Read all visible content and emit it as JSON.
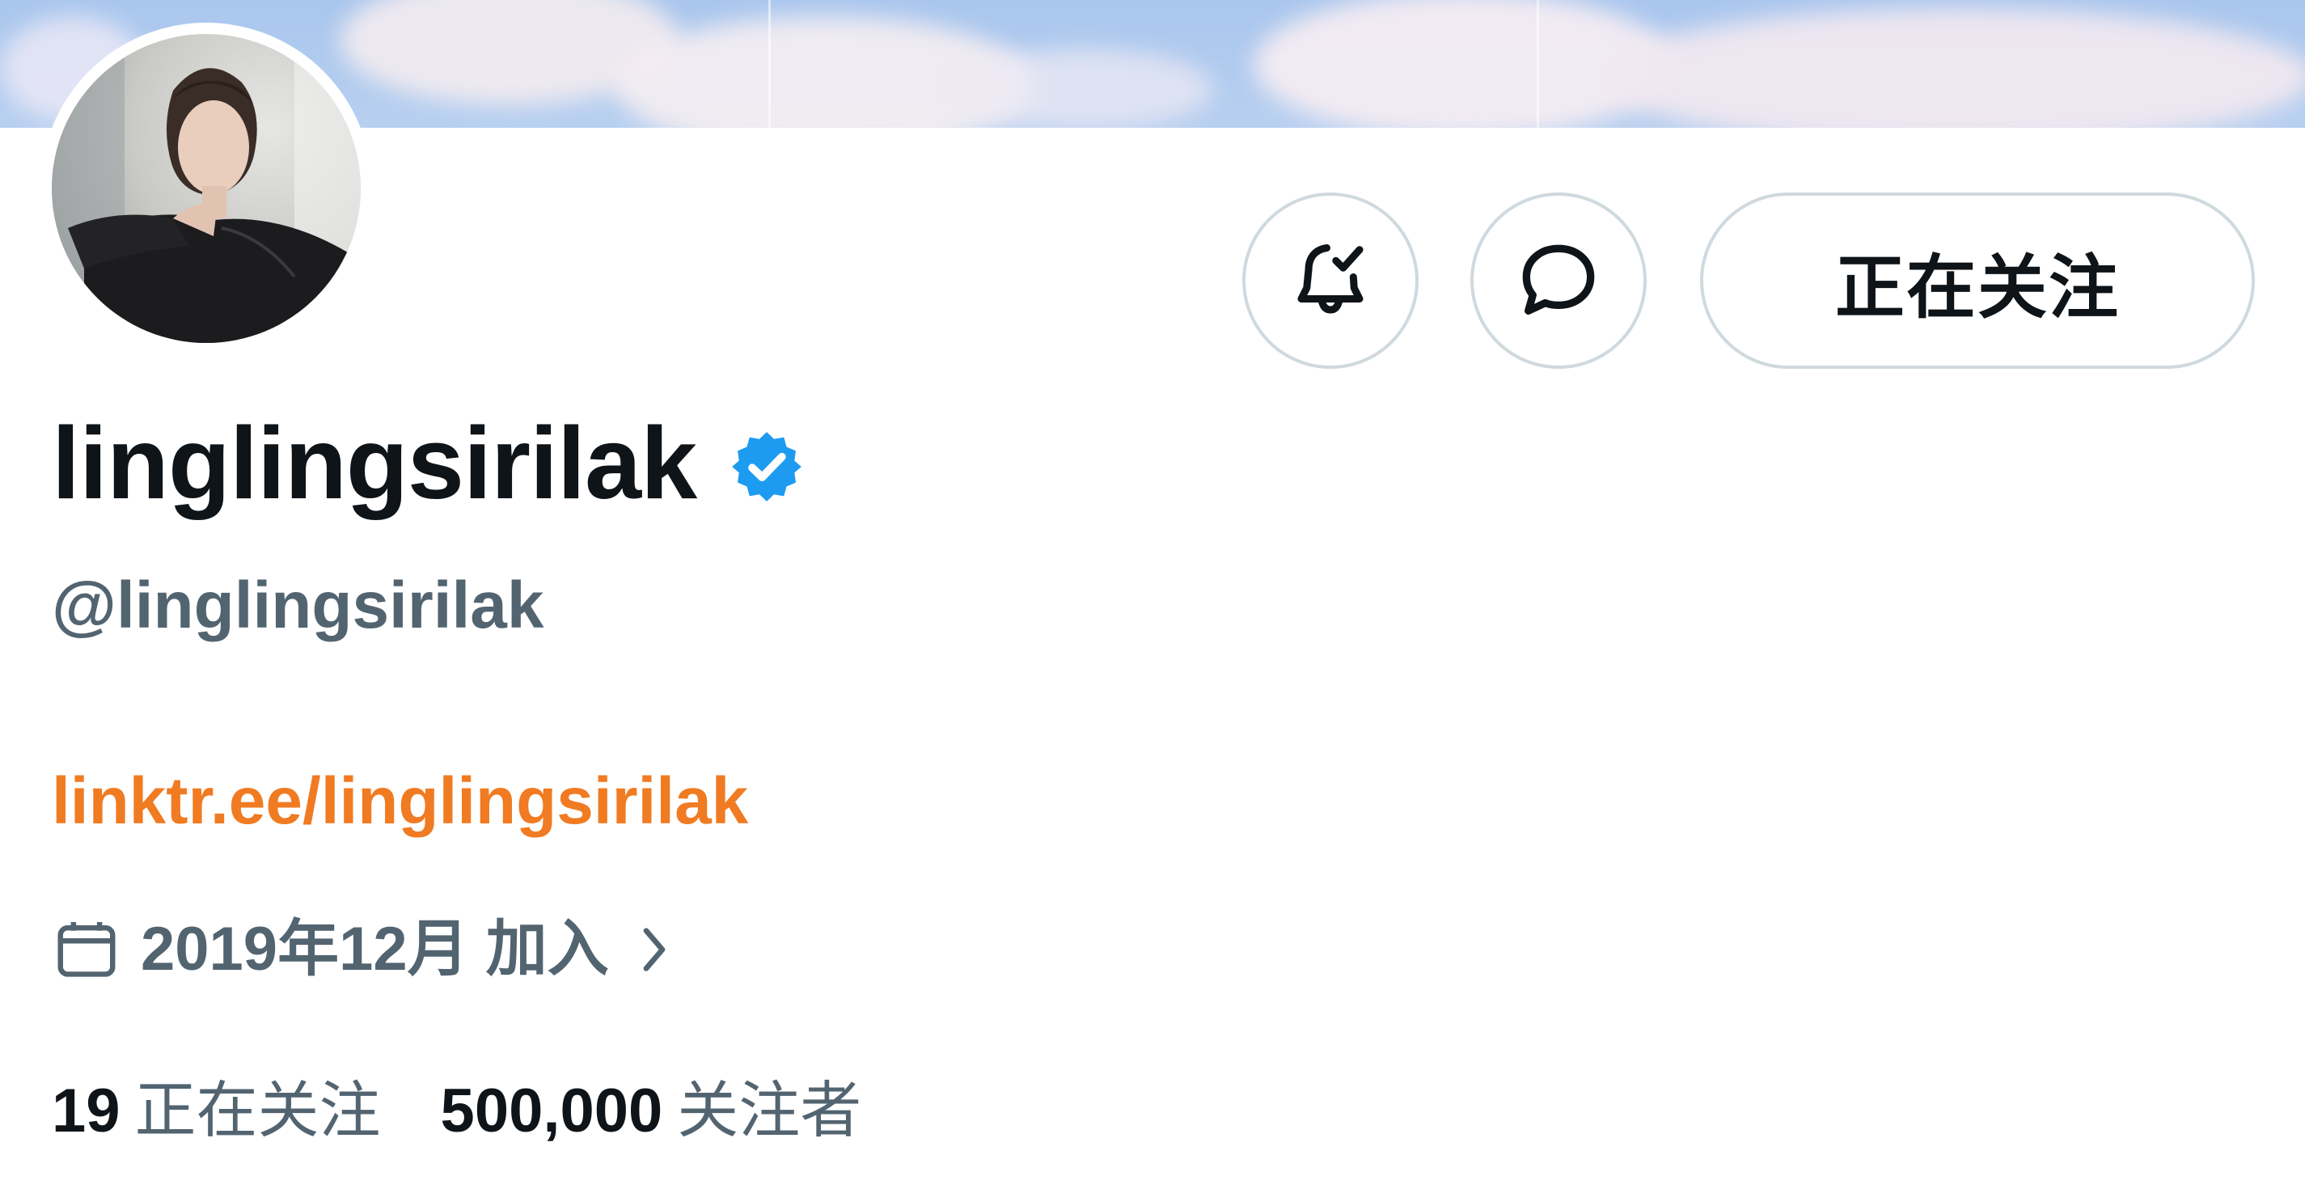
{
  "profile": {
    "display_name": "linglingsirilak",
    "handle": "@linglingsirilak",
    "link": "linktr.ee/linglingsirilak",
    "joined": "2019年12月 加入",
    "verified": true
  },
  "actions": {
    "notifications_icon": "bell-check-icon",
    "message_icon": "chat-bubble-icon",
    "follow_label": "正在关注"
  },
  "stats": {
    "following_count": "19",
    "following_label": "正在关注",
    "followers_count": "500,000",
    "followers_label": "关注者"
  },
  "colors": {
    "link": "#f07b22",
    "verified": "#1d9bf0",
    "secondary_text": "#536471",
    "primary_text": "#0f1419",
    "border": "#cfd9de"
  }
}
